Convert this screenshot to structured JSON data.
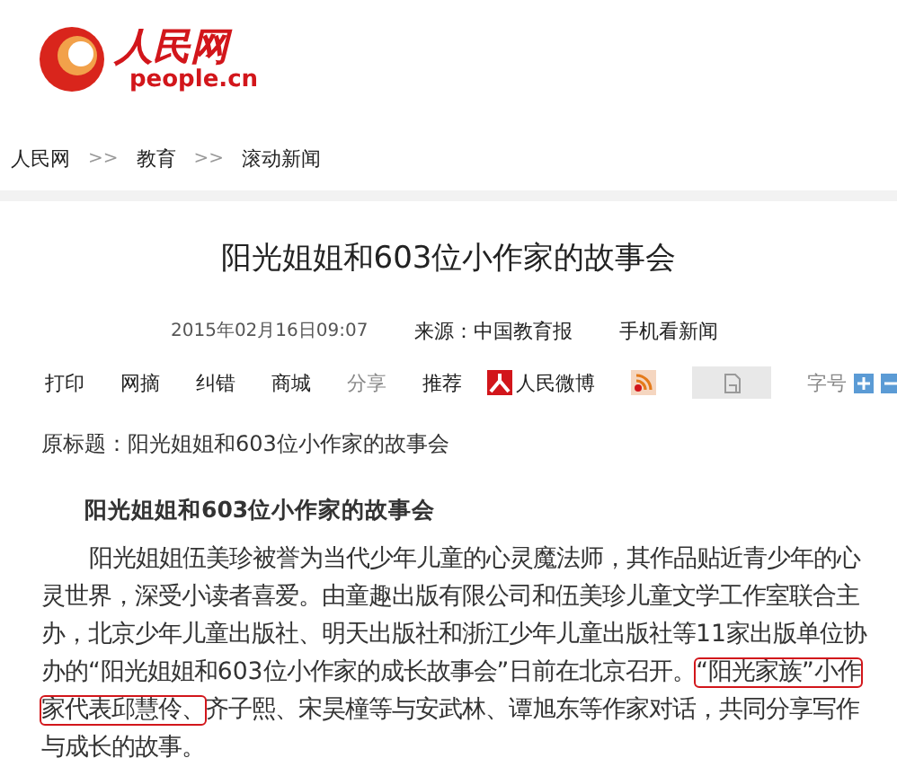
{
  "logo": {
    "brand": "人民网",
    "domain": "people.cn"
  },
  "breadcrumb": [
    {
      "label": "人民网"
    },
    {
      "label": "教育"
    },
    {
      "label": "滚动新闻"
    }
  ],
  "breadcrumb_separator": ">>",
  "headline": "阳光姐姐和603位小作家的故事会",
  "meta": {
    "datetime": "2015年02月16日09:07",
    "source": "来源：中国教育报",
    "mobile_link": "手机看新闻"
  },
  "toolbar": [
    {
      "kind": "link",
      "label": "打印"
    },
    {
      "kind": "link",
      "label": "网摘"
    },
    {
      "kind": "link",
      "label": "纠错"
    },
    {
      "kind": "link",
      "label": "商城"
    },
    {
      "kind": "muted",
      "label": "分享"
    },
    {
      "kind": "link",
      "label": "推荐"
    },
    {
      "kind": "weibo",
      "label": "人民微博"
    },
    {
      "kind": "rss"
    },
    {
      "kind": "box"
    },
    {
      "kind": "fontsize",
      "label": "字号"
    }
  ],
  "original_title": "原标题：阳光姐姐和603位小作家的故事会",
  "subtitle": "阳光姐姐和603位小作家的故事会",
  "body": {
    "before": "阳光姐姐伍美珍被誉为当代少年儿童的心灵魔法师，其作品贴近青少年的心灵世界，深受小读者喜爱。由童趣出版有限公司和伍美珍儿童文学工作室联合主办，北京少年儿童出版社、明天出版社和浙江少年儿童出版社等11家出版单位协办的“阳光姐姐和603位小作家的成长故事会”日前在北京召开。",
    "highlight": "“阳光家族”小作家代表邱慧伶、",
    "after": "齐子熙、宋昊橦等与安武林、谭旭东等作家对话，共同分享写作与成长的故事。"
  }
}
